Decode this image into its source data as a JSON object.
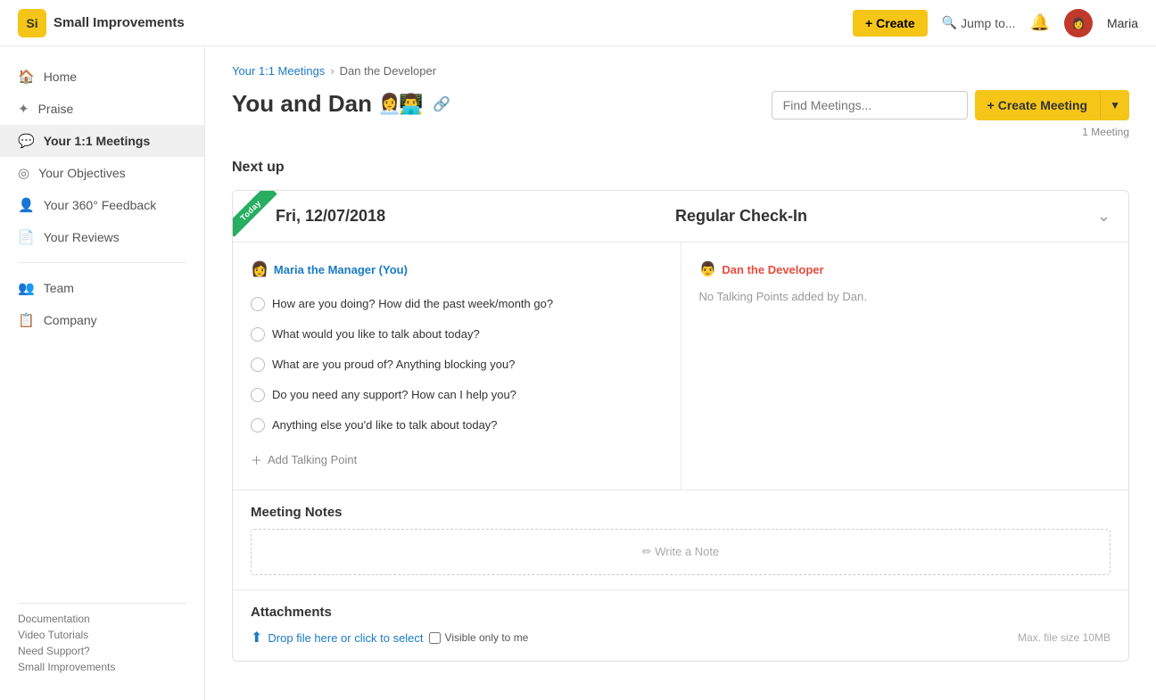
{
  "app": {
    "logo": "Si",
    "name": "Small Improvements"
  },
  "topnav": {
    "create_label": "+ Create",
    "jump_label": "Jump to...",
    "user_name": "Maria"
  },
  "sidebar": {
    "items": [
      {
        "id": "home",
        "label": "Home",
        "icon": "🏠",
        "active": false
      },
      {
        "id": "praise",
        "label": "Praise",
        "icon": "✦",
        "active": false
      },
      {
        "id": "meetings",
        "label": "Your 1:1 Meetings",
        "icon": "💬",
        "active": true
      },
      {
        "id": "objectives",
        "label": "Your Objectives",
        "icon": "◎",
        "active": false
      },
      {
        "id": "feedback",
        "label": "Your 360° Feedback",
        "icon": "👤",
        "active": false
      },
      {
        "id": "reviews",
        "label": "Your Reviews",
        "icon": "📄",
        "active": false
      }
    ],
    "group_items": [
      {
        "id": "team",
        "label": "Team",
        "icon": "👥",
        "active": false
      },
      {
        "id": "company",
        "label": "Company",
        "icon": "📋",
        "active": false
      }
    ],
    "footer_links": [
      "Documentation",
      "Video Tutorials",
      "Need Support?",
      "Small Improvements"
    ]
  },
  "breadcrumb": {
    "parent": "Your 1:1 Meetings",
    "current": "Dan the Developer"
  },
  "page": {
    "title": "You and Dan",
    "avatars": [
      "👩‍💼",
      "👨‍💻"
    ],
    "find_placeholder": "Find Meetings...",
    "create_meeting_label": "+ Create Meeting",
    "meeting_count": "1 Meeting",
    "section_title": "Next up"
  },
  "meeting": {
    "today_badge": "Today",
    "date": "Fri, 12/07/2018",
    "type": "Regular Check-In",
    "manager_name": "Maria the Manager (You)",
    "developer_name": "Dan the Developer",
    "no_points_text": "No Talking Points added by Dan.",
    "talking_points": [
      "How are you doing? How did the past week/month go?",
      "What would you like to talk about today?",
      "What are you proud of? Anything blocking you?",
      "Do you need any support? How can I help you?",
      "Anything else you'd like to talk about today?"
    ],
    "add_point_label": "Add Talking Point",
    "notes_section_title": "Meeting Notes",
    "notes_placeholder": "✏ Write a Note",
    "attachments_title": "Attachments",
    "drop_label": "Drop file here or click to select",
    "visible_label": "Visible only to me",
    "max_size_label": "Max. file size 10MB"
  }
}
